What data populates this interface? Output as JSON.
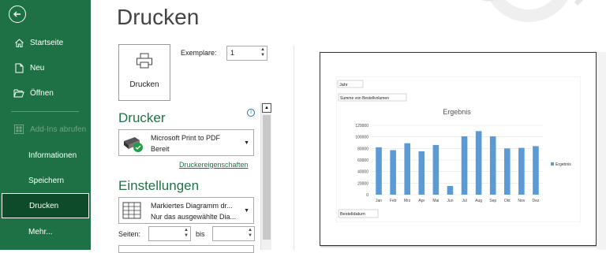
{
  "sidebar": {
    "items": [
      {
        "label": "Startseite",
        "icon": "home-icon"
      },
      {
        "label": "Neu",
        "icon": "new-document-icon"
      },
      {
        "label": "Öffnen",
        "icon": "folder-open-icon"
      },
      {
        "label": "Add-Ins abrufen",
        "icon": "addins-grid-icon"
      },
      {
        "label": "Informationen"
      },
      {
        "label": "Speichern"
      },
      {
        "label": "Drucken"
      },
      {
        "label": "Mehr..."
      }
    ]
  },
  "main": {
    "title": "Drucken",
    "print_button_label": "Drucken",
    "copies_label": "Exemplare:",
    "copies_value": "1",
    "printer_section_title": "Drucker",
    "printer_name": "Microsoft Print to PDF",
    "printer_status": "Bereit",
    "printer_properties_link": "Druckereigenschaften",
    "settings_section_title": "Einstellungen",
    "print_what_line1": "Markiertes Diagramm dr...",
    "print_what_line2": "Nur das ausgewählte Dia...",
    "pages_label": "Seiten:",
    "pages_to_label": "bis"
  },
  "colors": {
    "sidebar_bg": "#1e7145",
    "accent": "#217346",
    "bar": "#5b9bd5"
  },
  "chart_data": {
    "type": "bar",
    "title": "Ergebnis",
    "filter_top": "Jahr",
    "field_button": "Summe von Bestellvolumen",
    "axis_field_button": "Bestelldatum",
    "categories": [
      "Jan",
      "Feb",
      "Mrz",
      "Apr",
      "Mai",
      "Jun",
      "Jul",
      "Aug",
      "Sep",
      "Okt",
      "Nov",
      "Dez"
    ],
    "series": [
      {
        "name": "Ergebnis",
        "values": [
          82000,
          77000,
          89000,
          75000,
          86000,
          15000,
          101000,
          110000,
          101000,
          80000,
          81000,
          84000
        ]
      }
    ],
    "yticks": [
      "0",
      "20000",
      "40000",
      "60000",
      "80000",
      "100000",
      "120000"
    ],
    "ylim": [
      0,
      120000
    ],
    "legend": "right"
  }
}
